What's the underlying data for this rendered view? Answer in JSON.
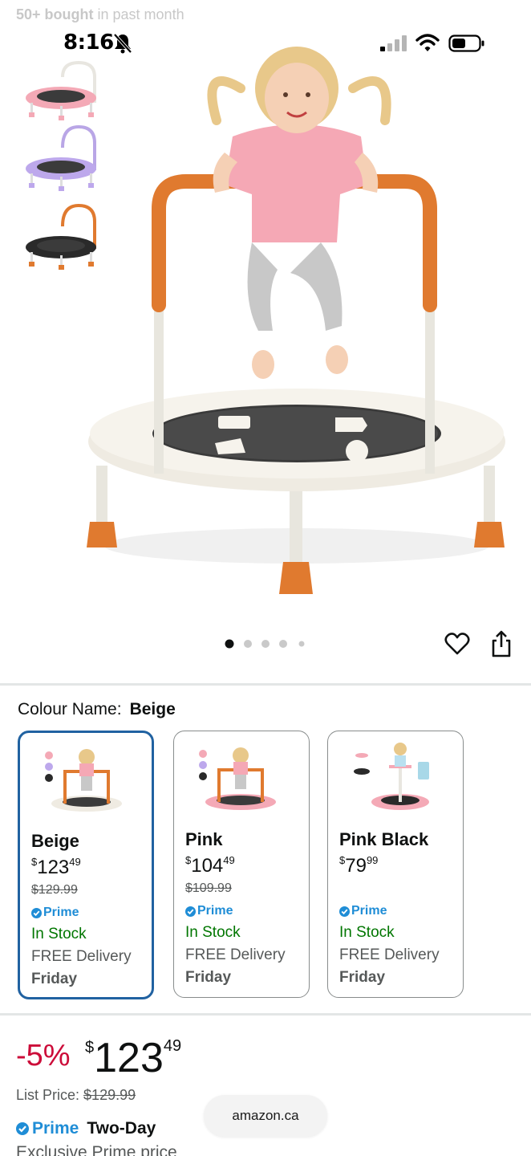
{
  "status_bar": {
    "bought_bold": "50+ bought",
    "bought_rest": " in past month",
    "time": "8:16"
  },
  "gallery": {
    "dot_count": 5,
    "active_dot": 0,
    "thumbnails": [
      "pink",
      "purple",
      "black"
    ]
  },
  "colour": {
    "label": "Colour Name:",
    "value": "Beige"
  },
  "variants": [
    {
      "name": "Beige",
      "price_symbol": "$",
      "price_whole": "123",
      "price_fraction": "49",
      "list_price": "$129.99",
      "prime": "Prime",
      "stock": "In Stock",
      "delivery": "FREE Delivery",
      "day": "Friday",
      "selected": true
    },
    {
      "name": "Pink",
      "price_symbol": "$",
      "price_whole": "104",
      "price_fraction": "49",
      "list_price": "$109.99",
      "prime": "Prime",
      "stock": "In Stock",
      "delivery": "FREE Delivery",
      "day": "Friday",
      "selected": false
    },
    {
      "name": "Pink Black",
      "price_symbol": "$",
      "price_whole": "79",
      "price_fraction": "99",
      "list_price": "",
      "prime": "Prime",
      "stock": "In Stock",
      "delivery": "FREE Delivery",
      "day": "Friday",
      "selected": false
    }
  ],
  "price": {
    "discount": "-5%",
    "symbol": "$",
    "whole": "123",
    "fraction": "49",
    "list_label": "List Price:",
    "list_value": "$129.99",
    "prime": "Prime",
    "prime_speed": "Two-Day",
    "exclusive": "Exclusive Prime price"
  },
  "browser": {
    "url": "amazon.ca"
  },
  "colors": {
    "accent_blue": "#2162a1",
    "prime_blue": "#1f8dd6",
    "stock_green": "#007600",
    "discount_red": "#cc0c39",
    "frame_orange": "#e07a2f"
  }
}
